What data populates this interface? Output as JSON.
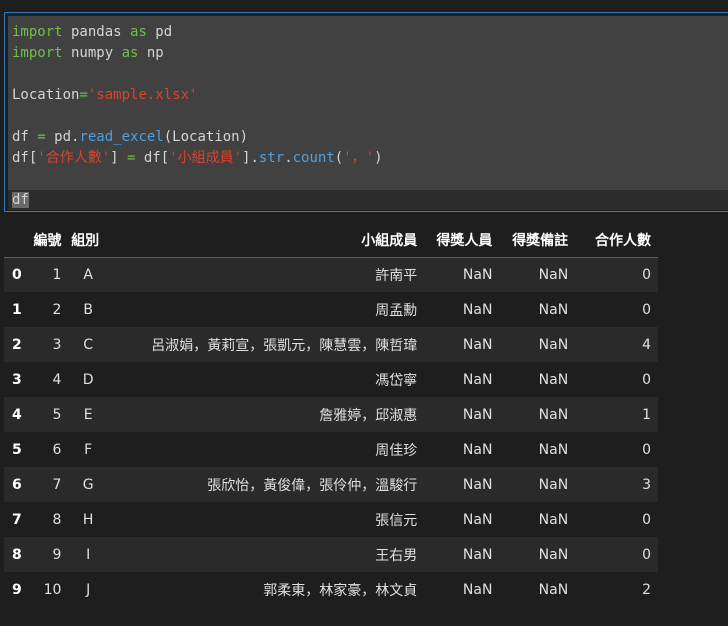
{
  "code_lines": [
    [
      {
        "t": "import",
        "c": "kw"
      },
      {
        "t": " pandas "
      },
      {
        "t": "as",
        "c": "kw"
      },
      {
        "t": " pd"
      }
    ],
    [
      {
        "t": "import",
        "c": "kw"
      },
      {
        "t": " numpy "
      },
      {
        "t": "as",
        "c": "kw"
      },
      {
        "t": " np"
      }
    ],
    [],
    [
      {
        "t": "Location"
      },
      {
        "t": "=",
        "c": "op"
      },
      {
        "t": "'sample.xlsx'",
        "c": "str"
      }
    ],
    [],
    [
      {
        "t": "df "
      },
      {
        "t": "=",
        "c": "op"
      },
      {
        "t": " pd."
      },
      {
        "t": "read_excel",
        "c": "fn"
      },
      {
        "t": "(Location)"
      }
    ],
    [
      {
        "t": "df["
      },
      {
        "t": "'合作人數'",
        "c": "str"
      },
      {
        "t": "] "
      },
      {
        "t": "=",
        "c": "op"
      },
      {
        "t": " df["
      },
      {
        "t": "'小組成員'",
        "c": "str"
      },
      {
        "t": "]."
      },
      {
        "t": "str",
        "c": "fn"
      },
      {
        "t": "."
      },
      {
        "t": "count",
        "c": "fn"
      },
      {
        "t": "("
      },
      {
        "t": "'，'",
        "c": "str"
      },
      {
        "t": ")"
      }
    ],
    [],
    [
      {
        "t": "df",
        "c": "cursor"
      }
    ]
  ],
  "table": {
    "columns": [
      "編號",
      "組別",
      "小組成員",
      "得獎人員",
      "得獎備註",
      "合作人數"
    ],
    "rows": [
      {
        "index": "0",
        "編號": "1",
        "組別": "A",
        "小組成員": "許南平",
        "得獎人員": "NaN",
        "得獎備註": "NaN",
        "合作人數": "0"
      },
      {
        "index": "1",
        "編號": "2",
        "組別": "B",
        "小組成員": "周孟勳",
        "得獎人員": "NaN",
        "得獎備註": "NaN",
        "合作人數": "0"
      },
      {
        "index": "2",
        "編號": "3",
        "組別": "C",
        "小組成員": "呂淑娟，黃莉宣，張凱元，陳慧雲，陳哲瑋",
        "得獎人員": "NaN",
        "得獎備註": "NaN",
        "合作人數": "4"
      },
      {
        "index": "3",
        "編號": "4",
        "組別": "D",
        "小組成員": "馮岱寧",
        "得獎人員": "NaN",
        "得獎備註": "NaN",
        "合作人數": "0"
      },
      {
        "index": "4",
        "編號": "5",
        "組別": "E",
        "小組成員": "詹雅婷，邱淑惠",
        "得獎人員": "NaN",
        "得獎備註": "NaN",
        "合作人數": "1"
      },
      {
        "index": "5",
        "編號": "6",
        "組別": "F",
        "小組成員": "周佳珍",
        "得獎人員": "NaN",
        "得獎備註": "NaN",
        "合作人數": "0"
      },
      {
        "index": "6",
        "編號": "7",
        "組別": "G",
        "小組成員": "張欣怡，黃俊偉，張伶仲，溫駿行",
        "得獎人員": "NaN",
        "得獎備註": "NaN",
        "合作人數": "3"
      },
      {
        "index": "7",
        "編號": "8",
        "組別": "H",
        "小組成員": "張信元",
        "得獎人員": "NaN",
        "得獎備註": "NaN",
        "合作人數": "0"
      },
      {
        "index": "8",
        "編號": "9",
        "組別": "I",
        "小組成員": "王右男",
        "得獎人員": "NaN",
        "得獎備註": "NaN",
        "合作人數": "0"
      },
      {
        "index": "9",
        "編號": "10",
        "組別": "J",
        "小組成員": "郭柔東，林家豪，林文貞",
        "得獎人員": "NaN",
        "得獎備註": "NaN",
        "合作人數": "2"
      }
    ]
  }
}
